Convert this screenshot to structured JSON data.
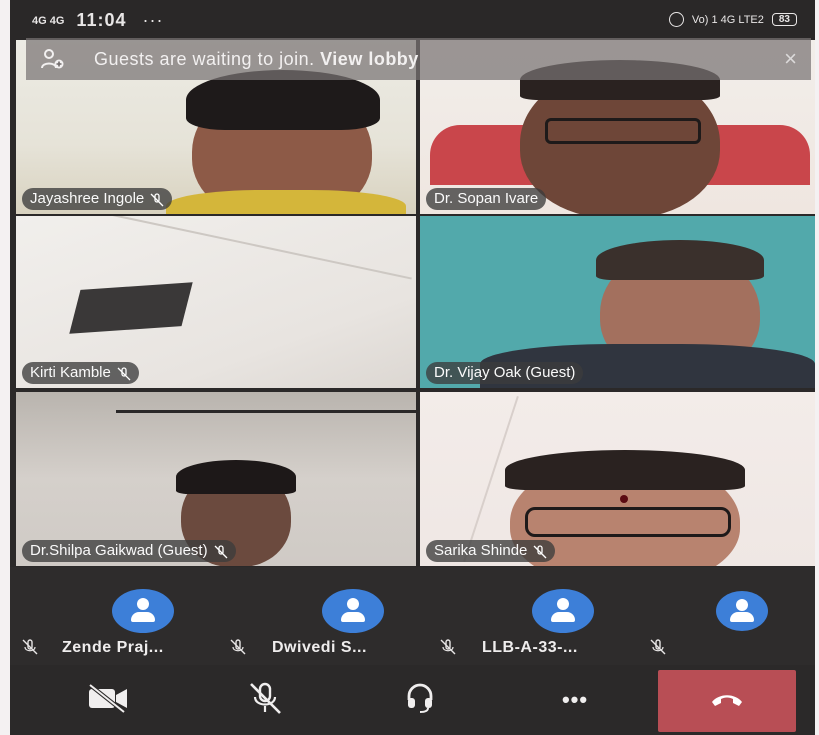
{
  "status_bar": {
    "network": "4G 4G",
    "time": "11:04",
    "more": "···",
    "right_network": "Vo) 1 4G LTE2",
    "battery": "83"
  },
  "banner": {
    "text": "Guests are waiting to join.",
    "action": "View lobby",
    "close": "×"
  },
  "tiles": [
    {
      "name": "Jayashree Ingole",
      "muted": true
    },
    {
      "name": "Dr. Sopan Ivare",
      "muted": false
    },
    {
      "name": "Kirti Kamble",
      "muted": true
    },
    {
      "name": "Dr. Vijay Oak (Guest)",
      "muted": false
    },
    {
      "name": "Dr.Shilpa Gaikwad (Guest)",
      "muted": true
    },
    {
      "name": "Sarika Shinde",
      "muted": true
    }
  ],
  "strip": [
    {
      "name": "Zende Praj...",
      "muted": true
    },
    {
      "name": "Dwivedi S...",
      "muted": true
    },
    {
      "name": "LLB-A-33-...",
      "muted": true
    },
    {
      "name": "",
      "muted": false
    }
  ],
  "controls": {
    "camera": "camera-off-icon",
    "mic": "mic-off-icon",
    "audio": "headset-icon",
    "more": "•••",
    "hangup": "hang-up-icon"
  },
  "colors": {
    "hangup": "#b84e55",
    "avatar": "#3d7fd8",
    "background": "#2b2929"
  }
}
